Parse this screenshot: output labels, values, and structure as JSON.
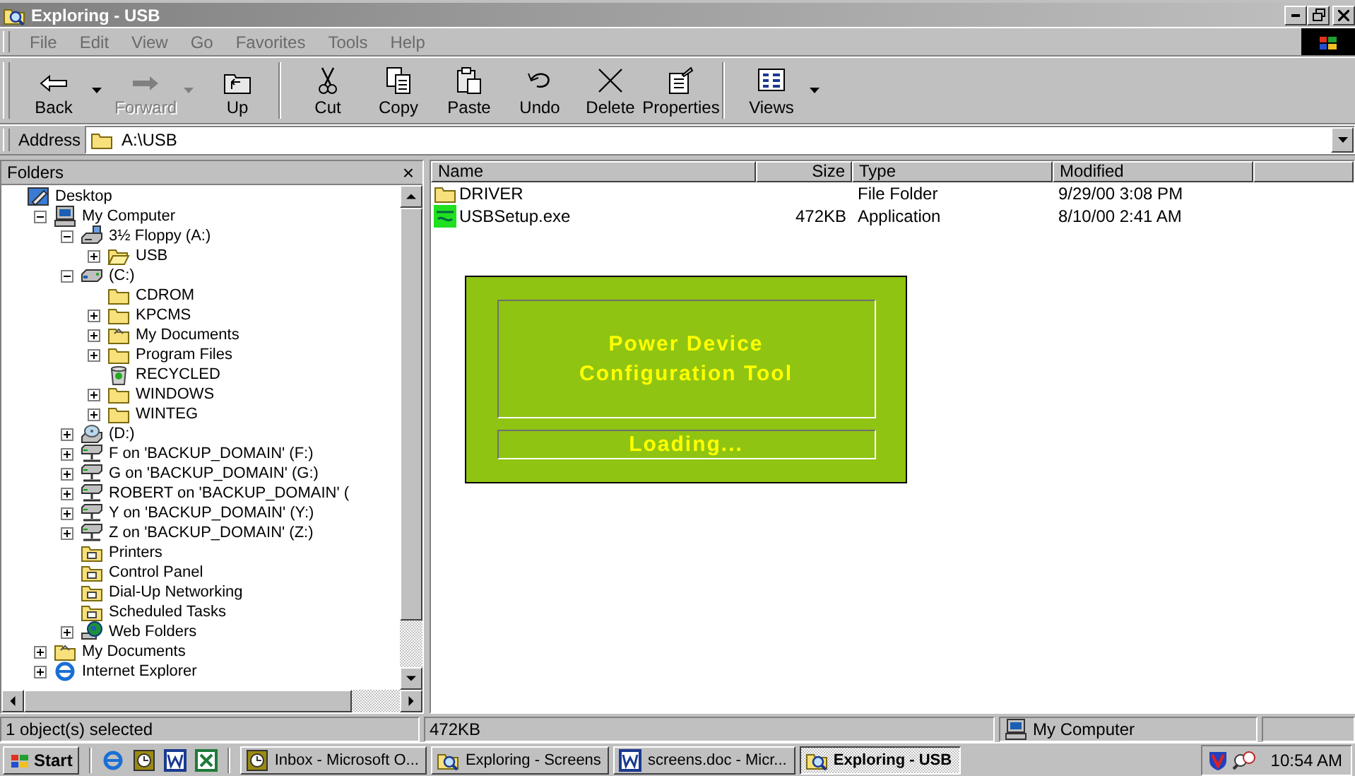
{
  "window": {
    "title": "Exploring - USB"
  },
  "menu": [
    "File",
    "Edit",
    "View",
    "Go",
    "Favorites",
    "Tools",
    "Help"
  ],
  "toolbar": [
    [
      {
        "kind": "back",
        "label": "Back",
        "disabled": false,
        "dropdown": true
      },
      {
        "kind": "forward",
        "label": "Forward",
        "disabled": true,
        "dropdown": true
      },
      {
        "kind": "up",
        "label": "Up",
        "disabled": false,
        "dropdown": false
      }
    ],
    [
      {
        "kind": "cut",
        "label": "Cut",
        "disabled": false,
        "dropdown": false
      },
      {
        "kind": "copy",
        "label": "Copy",
        "disabled": false,
        "dropdown": false
      },
      {
        "kind": "paste",
        "label": "Paste",
        "disabled": false,
        "dropdown": false
      },
      {
        "kind": "undo",
        "label": "Undo",
        "disabled": false,
        "dropdown": false
      },
      {
        "kind": "delete",
        "label": "Delete",
        "disabled": false,
        "dropdown": false
      },
      {
        "kind": "properties",
        "label": "Properties",
        "disabled": false,
        "dropdown": false
      }
    ],
    [
      {
        "kind": "views",
        "label": "Views",
        "disabled": false,
        "dropdown": true
      }
    ]
  ],
  "address": {
    "label": "Address",
    "value": "A:\\USB"
  },
  "folders": {
    "title": "Folders",
    "close": "×",
    "tree": [
      {
        "label": "Desktop",
        "kind": "desktop",
        "expandable": false,
        "children": [
          {
            "label": "My Computer",
            "kind": "computer",
            "expandable": true,
            "expanded": true,
            "children": [
              {
                "label": "3½ Floppy (A:)",
                "kind": "floppy",
                "expandable": true,
                "expanded": true,
                "children": [
                  {
                    "label": "USB",
                    "kind": "open-folder",
                    "expandable": true,
                    "expanded": false
                  }
                ]
              },
              {
                "label": "(C:)",
                "kind": "harddrive",
                "expandable": true,
                "expanded": true,
                "children": [
                  {
                    "label": "CDROM",
                    "kind": "folder",
                    "expandable": false
                  },
                  {
                    "label": "KPCMS",
                    "kind": "folder",
                    "expandable": true,
                    "expanded": false
                  },
                  {
                    "label": "My Documents",
                    "kind": "documents",
                    "expandable": true,
                    "expanded": false
                  },
                  {
                    "label": "Program Files",
                    "kind": "folder",
                    "expandable": true,
                    "expanded": false
                  },
                  {
                    "label": "RECYCLED",
                    "kind": "recycle",
                    "expandable": false
                  },
                  {
                    "label": "WINDOWS",
                    "kind": "folder",
                    "expandable": true,
                    "expanded": false
                  },
                  {
                    "label": "WINTEG",
                    "kind": "folder",
                    "expandable": true,
                    "expanded": false
                  }
                ]
              },
              {
                "label": "(D:)",
                "kind": "cdrom",
                "expandable": true,
                "expanded": false
              },
              {
                "label": "F on 'BACKUP_DOMAIN' (F:)",
                "kind": "netdrive",
                "expandable": true,
                "expanded": false
              },
              {
                "label": "G on 'BACKUP_DOMAIN' (G:)",
                "kind": "netdrive",
                "expandable": true,
                "expanded": false
              },
              {
                "label": "ROBERT on 'BACKUP_DOMAIN' (",
                "kind": "netdrive",
                "expandable": true,
                "expanded": false
              },
              {
                "label": "Y on 'BACKUP_DOMAIN' (Y:)",
                "kind": "netdrive",
                "expandable": true,
                "expanded": false
              },
              {
                "label": "Z on 'BACKUP_DOMAIN' (Z:)",
                "kind": "netdrive",
                "expandable": true,
                "expanded": false
              },
              {
                "label": "Printers",
                "kind": "special",
                "expandable": false
              },
              {
                "label": "Control Panel",
                "kind": "special",
                "expandable": false
              },
              {
                "label": "Dial-Up Networking",
                "kind": "special",
                "expandable": false
              },
              {
                "label": "Scheduled Tasks",
                "kind": "special",
                "expandable": false
              },
              {
                "label": "Web Folders",
                "kind": "web",
                "expandable": true,
                "expanded": false
              }
            ]
          },
          {
            "label": "My Documents",
            "kind": "documents",
            "expandable": true,
            "expanded": false
          },
          {
            "label": "Internet Explorer",
            "kind": "ie",
            "expandable": true,
            "expanded": false
          }
        ]
      }
    ]
  },
  "files": {
    "columns": [
      "Name",
      "Size",
      "Type",
      "Modified"
    ],
    "rows": [
      {
        "kind": "folder",
        "name": "DRIVER",
        "size": "",
        "type": "File Folder",
        "modified": "9/29/00 3:08 PM"
      },
      {
        "kind": "app",
        "name": "USBSetup.exe",
        "size": "472KB",
        "type": "Application",
        "modified": "8/10/00 2:41 AM"
      }
    ]
  },
  "splash": {
    "title": "Power Device Configuration Tool",
    "status": "Loading..."
  },
  "status_bar": {
    "selection": "1 object(s) selected",
    "size": "472KB",
    "location": "My Computer"
  },
  "taskbar": {
    "start": "Start",
    "quick_launch": [
      {
        "kind": "ie"
      },
      {
        "kind": "outlook"
      },
      {
        "kind": "word"
      },
      {
        "kind": "excel"
      }
    ],
    "tasks": [
      {
        "kind": "outlook",
        "label": "Inbox - Microsoft O...",
        "selected": false
      },
      {
        "kind": "explorer",
        "label": "Exploring - Screens",
        "selected": false
      },
      {
        "kind": "word",
        "label": "screens.doc - Micr...",
        "selected": false
      },
      {
        "kind": "explorer",
        "label": "Exploring - USB",
        "selected": true
      }
    ],
    "clock": "10:54 AM"
  }
}
